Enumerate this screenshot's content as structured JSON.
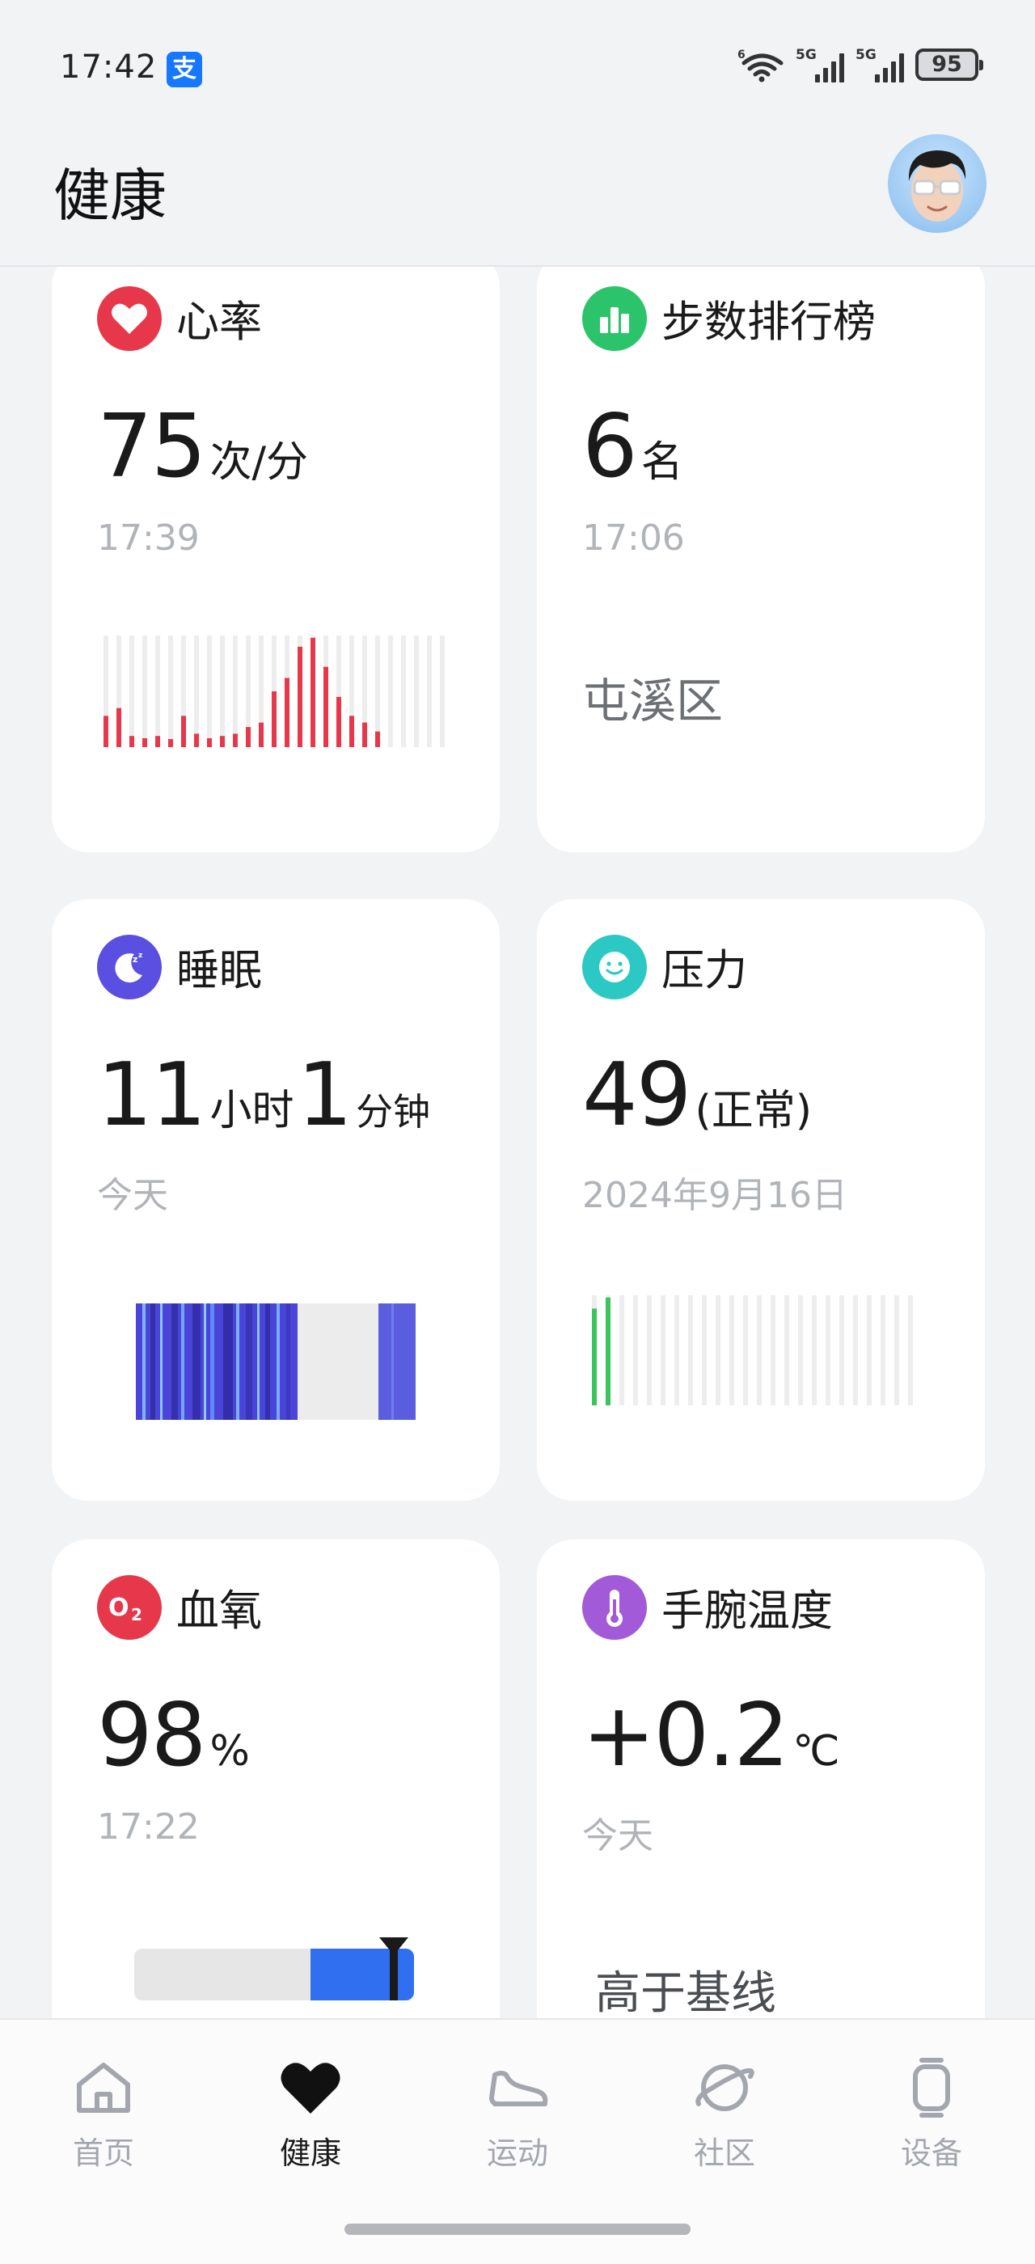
{
  "status_bar": {
    "time": "17:42",
    "app_badge": "支",
    "network_1": "5G",
    "network_2": "5G",
    "battery": "95"
  },
  "header": {
    "title": "健康",
    "avatar_icon": "avatar-icon"
  },
  "cards": {
    "heart_rate": {
      "title": "心率",
      "value": "75",
      "unit": "次/分",
      "time": "17:39",
      "color": "#e6384a",
      "icon": "heart-icon",
      "bars": [
        0.28,
        0.35,
        0.1,
        0.08,
        0.1,
        0.06,
        0.28,
        0.12,
        0.08,
        0.1,
        0.12,
        0.18,
        0.22,
        0.5,
        0.62,
        0.9,
        0.98,
        0.72,
        0.45,
        0.28,
        0.22,
        0.14,
        0,
        0,
        0,
        0,
        0
      ]
    },
    "steps_rank": {
      "title": "步数排行榜",
      "value": "6",
      "unit": "名",
      "time": "17:06",
      "district": "屯溪区",
      "color": "#2bc46a",
      "icon": "bar-chart-icon"
    },
    "sleep": {
      "title": "睡眠",
      "hours": "11",
      "hours_unit": "小时",
      "minutes": "1",
      "minutes_unit": "分钟",
      "date": "今天",
      "color": "#5a4fe0",
      "icon": "moon-icon"
    },
    "stress": {
      "title": "压力",
      "value": "49",
      "status": "(正常)",
      "date": "2024年9月16日",
      "color": "#2cc9c4",
      "icon": "smile-icon",
      "bars": [
        0.88,
        0.98,
        0,
        0,
        0,
        0,
        0,
        0,
        0,
        0,
        0,
        0,
        0,
        0,
        0,
        0,
        0,
        0,
        0,
        0,
        0,
        0,
        0,
        0
      ]
    },
    "spo2": {
      "title": "血氧",
      "value": "98",
      "unit": "%",
      "time": "17:22",
      "color": "#e6384a",
      "icon": "o2-icon",
      "level": 0.98
    },
    "wrist_temp": {
      "title": "手腕温度",
      "value": "+0.2",
      "unit": "℃",
      "date": "今天",
      "note": "高于基线",
      "color": "#a25ad8",
      "icon": "thermometer-icon"
    }
  },
  "nav": {
    "items": [
      {
        "label": "首页",
        "icon": "home-icon"
      },
      {
        "label": "健康",
        "icon": "heart-icon"
      },
      {
        "label": "运动",
        "icon": "shoe-icon"
      },
      {
        "label": "社区",
        "icon": "planet-icon"
      },
      {
        "label": "设备",
        "icon": "watch-icon"
      }
    ],
    "active": "健康"
  }
}
